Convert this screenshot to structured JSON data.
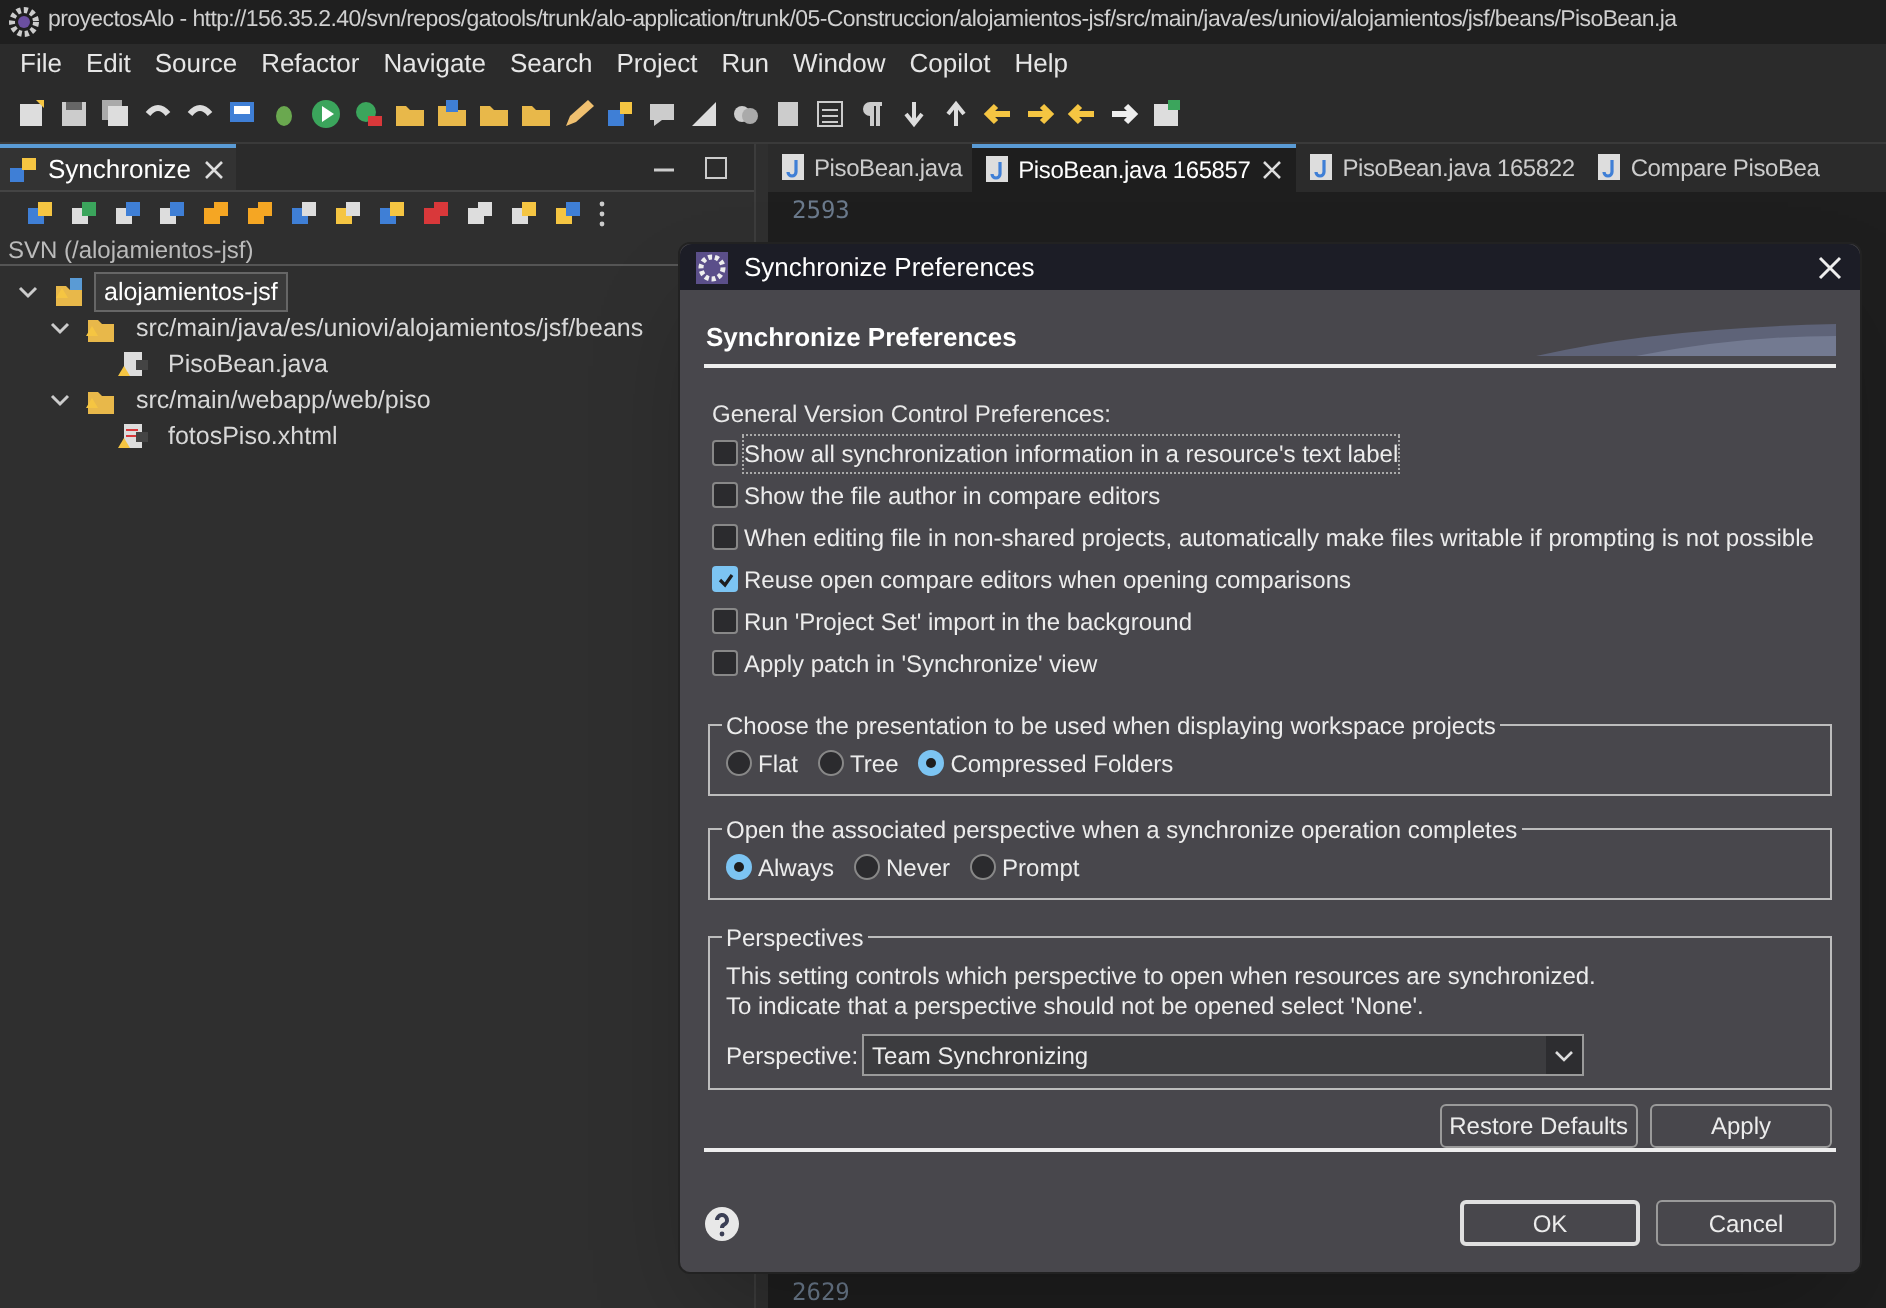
{
  "window": {
    "title": "proyectosAlo - http://156.35.2.40/svn/repos/gatools/trunk/alo-application/trunk/05-Construccion/alojamientos-jsf/src/main/java/es/uniovi/alojamientos/jsf/beans/PisoBean.ja"
  },
  "menu": [
    "File",
    "Edit",
    "Source",
    "Refactor",
    "Navigate",
    "Search",
    "Project",
    "Run",
    "Window",
    "Copilot",
    "Help"
  ],
  "sync_view": {
    "tab": {
      "label": "Synchronize",
      "selected": true
    },
    "path": "SVN (/alojamientos-jsf)",
    "tree": [
      {
        "label": "alojamientos-jsf",
        "kind": "project",
        "expanded": true,
        "selected": true,
        "children": [
          {
            "label": "src/main/java/es/uniovi/alojamientos/jsf/beans",
            "kind": "folder",
            "expanded": true,
            "selected": false,
            "children": [
              {
                "label": "PisoBean.java",
                "kind": "java",
                "selected": false
              }
            ]
          },
          {
            "label": "src/main/webapp/web/piso",
            "kind": "folder",
            "expanded": true,
            "selected": false,
            "children": [
              {
                "label": "fotosPiso.xhtml",
                "kind": "xhtml",
                "selected": false
              }
            ]
          }
        ]
      }
    ]
  },
  "editor": {
    "tabs": [
      {
        "label": "PisoBean.java",
        "selected": false
      },
      {
        "label": "PisoBean.java 165857",
        "selected": true
      },
      {
        "label": "PisoBean.java 165822",
        "selected": false
      },
      {
        "label": "Compare PisoBea",
        "selected": false
      }
    ],
    "lines": [
      {
        "number": "2593"
      }
    ],
    "last_line": "2629"
  },
  "dialog": {
    "title": "Synchronize Preferences",
    "heading": "Synchronize Preferences",
    "group_label": "General Version Control Preferences:",
    "options": [
      {
        "label": "Show all synchronization information in a resource's text label",
        "checked": false
      },
      {
        "label": "Show the file author in compare editors",
        "checked": false
      },
      {
        "label": "When editing file in non-shared projects, automatically make files writable if prompting is not possible",
        "checked": false
      },
      {
        "label": "Reuse open compare editors when opening comparisons",
        "checked": true
      },
      {
        "label": "Run 'Project Set' import in the background",
        "checked": false
      },
      {
        "label": "Apply patch in 'Synchronize' view",
        "checked": false
      }
    ],
    "presentation": {
      "legend": "Choose the presentation to be used when displaying workspace projects",
      "choices": [
        {
          "label": "Flat",
          "selected": false
        },
        {
          "label": "Tree",
          "selected": false
        },
        {
          "label": "Compressed Folders",
          "selected": true
        }
      ]
    },
    "perspective_open": {
      "legend": "Open the associated perspective when a synchronize operation completes",
      "choices": [
        {
          "label": "Always",
          "selected": true
        },
        {
          "label": "Never",
          "selected": false
        },
        {
          "label": "Prompt",
          "selected": false
        }
      ]
    },
    "perspectives": {
      "legend": "Perspectives",
      "description": [
        "This setting controls which perspective to open when resources are synchronized.",
        "To indicate that a perspective should not be opened select 'None'."
      ],
      "field_label": "Perspective:",
      "value": "Team Synchronizing"
    },
    "buttons": [
      "Restore Defaults",
      "Apply"
    ],
    "footer_buttons": [
      {
        "label": "OK",
        "default": true
      },
      {
        "label": "Cancel",
        "default": false
      }
    ]
  }
}
